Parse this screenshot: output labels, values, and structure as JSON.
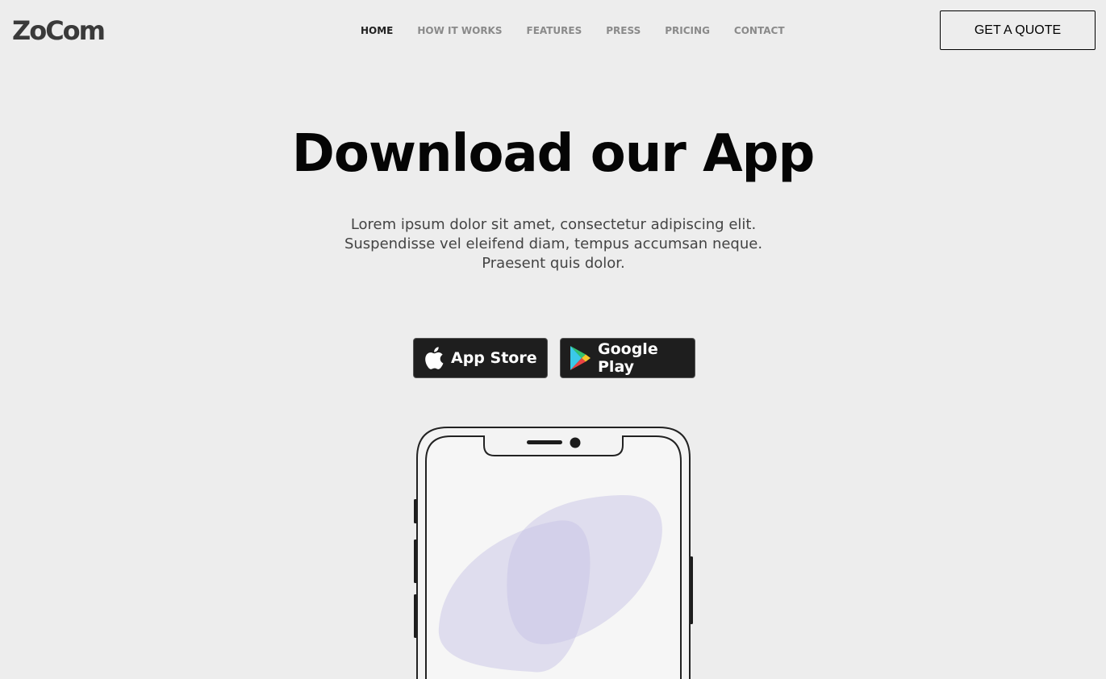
{
  "brand": {
    "logo_text": "ZoCom"
  },
  "nav": {
    "items": [
      {
        "label": "HOME",
        "active": true
      },
      {
        "label": "HOW IT WORKS",
        "active": false
      },
      {
        "label": "FEATURES",
        "active": false
      },
      {
        "label": "PRESS",
        "active": false
      },
      {
        "label": "PRICING",
        "active": false
      },
      {
        "label": "CONTACT",
        "active": false
      }
    ],
    "cta_label": "GET A QUOTE"
  },
  "hero": {
    "title": "Download our App",
    "subtitle": "Lorem ipsum dolor sit amet, consectetur adipiscing elit. Suspendisse vel eleifend diam, tempus accumsan neque. Praesent quis dolor."
  },
  "stores": {
    "app_store": {
      "label": "App Store",
      "icon": "apple-icon"
    },
    "google_play": {
      "label": "Google Play",
      "icon": "google-play-icon"
    }
  },
  "colors": {
    "background": "#ededed",
    "blob": "#d6d3ec"
  }
}
